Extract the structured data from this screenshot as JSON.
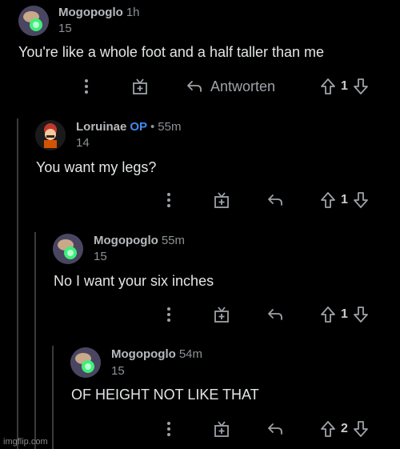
{
  "comments": [
    {
      "author": "Mogopoglo",
      "op": "",
      "time": "1h",
      "karma": "15",
      "text": "You're like a whole foot and a half taller than me",
      "reply_label": "Antworten",
      "votes": "1"
    },
    {
      "author": "Loruinae",
      "op": "OP",
      "dot": "•",
      "time": "55m",
      "karma": "14",
      "text": "You want my legs?",
      "reply_label": "",
      "votes": "1"
    },
    {
      "author": "Mogopoglo",
      "op": "",
      "time": "55m",
      "karma": "15",
      "text": "No I want your six inches",
      "reply_label": "",
      "votes": "1"
    },
    {
      "author": "Mogopoglo",
      "op": "",
      "time": "54m",
      "karma": "15",
      "text": "OF HEIGHT NOT LIKE THAT",
      "reply_label": "",
      "votes": "2"
    }
  ],
  "icons": {
    "more": "more-options-icon",
    "award": "award-icon",
    "reply": "reply-arrow-icon",
    "upvote": "upvote-arrow-icon",
    "downvote": "downvote-arrow-icon"
  },
  "watermark": "imgflip.com",
  "colors": {
    "background": "#000000",
    "op_badge": "#3f8cf0",
    "thread_line": "#3a3a3c"
  }
}
